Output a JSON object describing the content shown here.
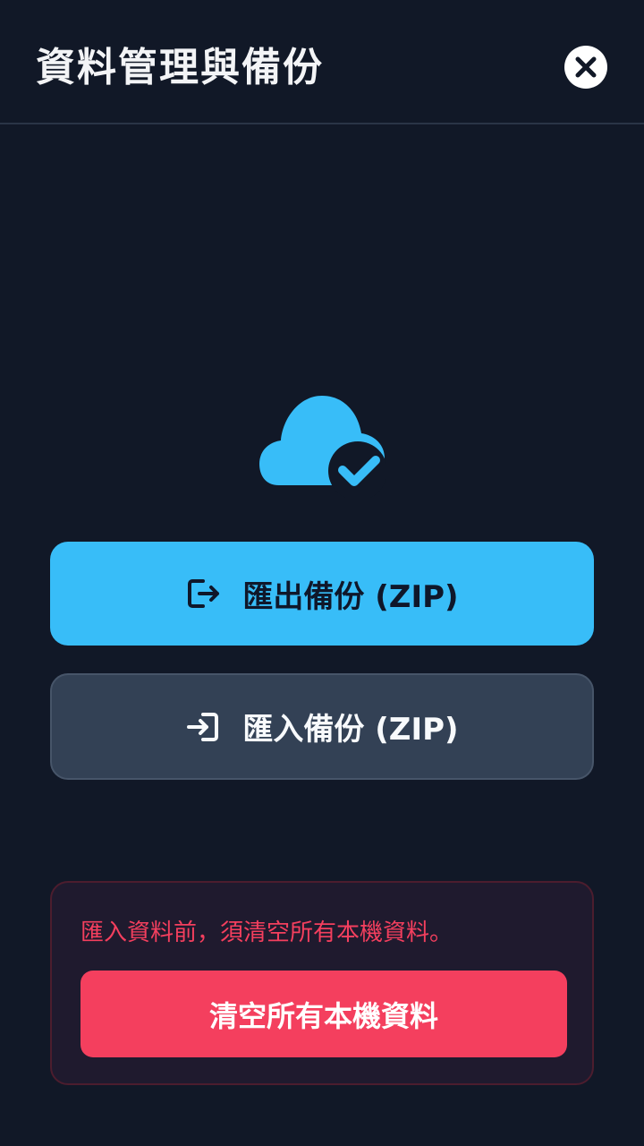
{
  "header": {
    "title": "資料管理與備份",
    "close_icon": "close-icon"
  },
  "hero": {
    "icon": "cloud-check-icon",
    "icon_color": "#38bdf8"
  },
  "actions": {
    "export_label": "匯出備份 (ZIP)",
    "export_icon": "export-icon",
    "import_label": "匯入備份 (ZIP)",
    "import_icon": "import-icon"
  },
  "danger_zone": {
    "warning": "匯入資料前，須清空所有本機資料。",
    "clear_label": "清空所有本機資料",
    "accent_color": "#f43f5e"
  },
  "colors": {
    "background": "#111827",
    "primary": "#38bdf8",
    "secondary": "#334155",
    "danger": "#f43f5e"
  }
}
